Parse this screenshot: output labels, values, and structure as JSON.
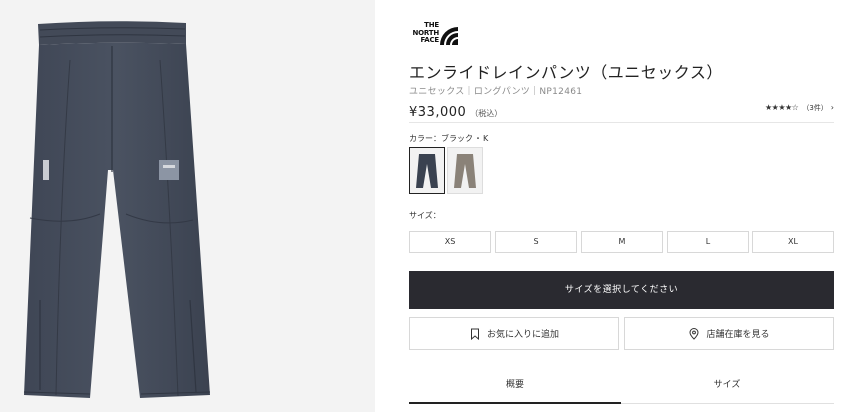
{
  "brand": {
    "logo_text_lines": [
      "THE",
      "NORTH",
      "FACE"
    ]
  },
  "product": {
    "title": "エンライドレインパンツ（ユニセックス）",
    "meta": "ユニセックス｜ロングパンツ｜NP12461",
    "price": "¥33,000",
    "tax_note": "（税込）"
  },
  "rating": {
    "stars": "★★★★☆",
    "count": "（3件）",
    "chevron": "›"
  },
  "color": {
    "label": "カラー：",
    "selected_name": "ブラック",
    "sep": "・",
    "code": "K"
  },
  "swatches": [
    {
      "name": "black",
      "color": "#3a4250",
      "selected": true
    },
    {
      "name": "khaki",
      "color": "#8a8278",
      "selected": false
    }
  ],
  "size": {
    "label": "サイズ：",
    "options": [
      "XS",
      "S",
      "M",
      "L",
      "XL"
    ]
  },
  "buttons": {
    "select_size": "サイズを選択してください",
    "favorite": "お気に入りに追加",
    "store_stock": "店舗在庫を見る"
  },
  "tabs": [
    {
      "label": "概要",
      "active": true
    },
    {
      "label": "サイズ",
      "active": false
    }
  ]
}
